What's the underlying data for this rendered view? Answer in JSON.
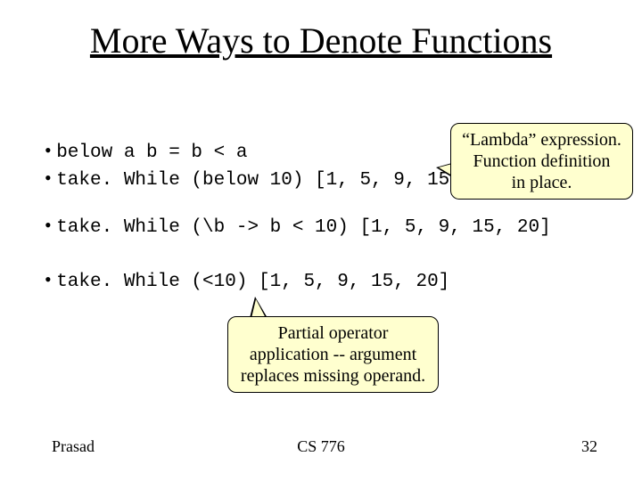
{
  "title": "More Ways to Denote Functions",
  "bullet_glyph": "•",
  "code_lines": {
    "l1": "below a b = b < a",
    "l2": "take. While (below 10) [1, 5, 9, 15, 20]",
    "l3": "take. While (\\b -> b < 10) [1, 5, 9, 15, 20]",
    "l4": "take. While (<10) [1, 5, 9, 15, 20]"
  },
  "callouts": {
    "lambda": "“Lambda” expression.\nFunction definition\nin place.",
    "partial": "Partial operator\napplication -- argument\nreplaces missing operand."
  },
  "footer": {
    "left": "Prasad",
    "center": "CS 776",
    "right": "32"
  }
}
